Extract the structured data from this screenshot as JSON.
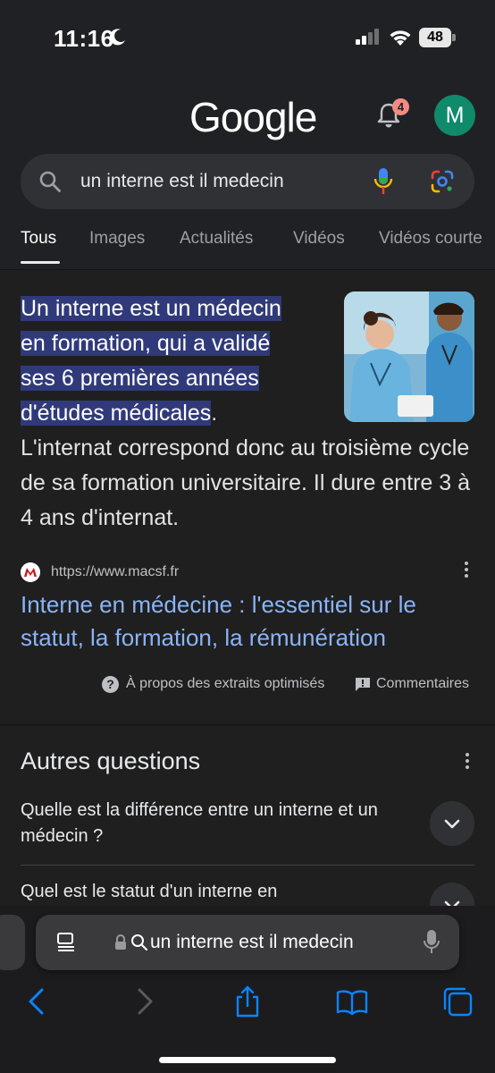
{
  "status_bar": {
    "time": "11:16",
    "battery": "48"
  },
  "header": {
    "logo": "Google",
    "notification_count": "4",
    "avatar_letter": "M"
  },
  "search": {
    "query": "un interne est il medecin"
  },
  "tabs": [
    {
      "label": "Tous",
      "active": true
    },
    {
      "label": "Images",
      "active": false
    },
    {
      "label": "Actualités",
      "active": false
    },
    {
      "label": "Vidéos",
      "active": false
    },
    {
      "label": "Vidéos courte",
      "active": false
    }
  ],
  "snippet": {
    "highlight_lines": [
      "Un interne est un médecin",
      "en formation, qui a validé",
      "ses 6 premières années",
      "d'études médicales"
    ],
    "after_highlight": ".",
    "rest": "L'internat correspond donc au troisième cycle de sa formation universitaire. Il dure entre 3 à 4 ans d'internat.",
    "source_url": "https://www.macsf.fr",
    "link_title": "Interne en médecine : l'essentiel sur le statut, la formation, la rémunération",
    "about_label": "À propos des extraits optimisés",
    "comments_label": "Commentaires",
    "image_alt_icon": "medical-staff-photo"
  },
  "paa": {
    "title": "Autres questions",
    "questions": [
      "Quelle est la différence entre un interne et un médecin ?",
      "Quel est le statut d'un interne en"
    ]
  },
  "safari": {
    "address": "un interne est il medecin"
  },
  "colors": {
    "background": "#1f1f1f",
    "link": "#8ab4f8",
    "highlight": "#303a7a",
    "badge": "#f28b82",
    "avatar": "#0f8a6a",
    "safari_accent": "#0a84ff"
  }
}
